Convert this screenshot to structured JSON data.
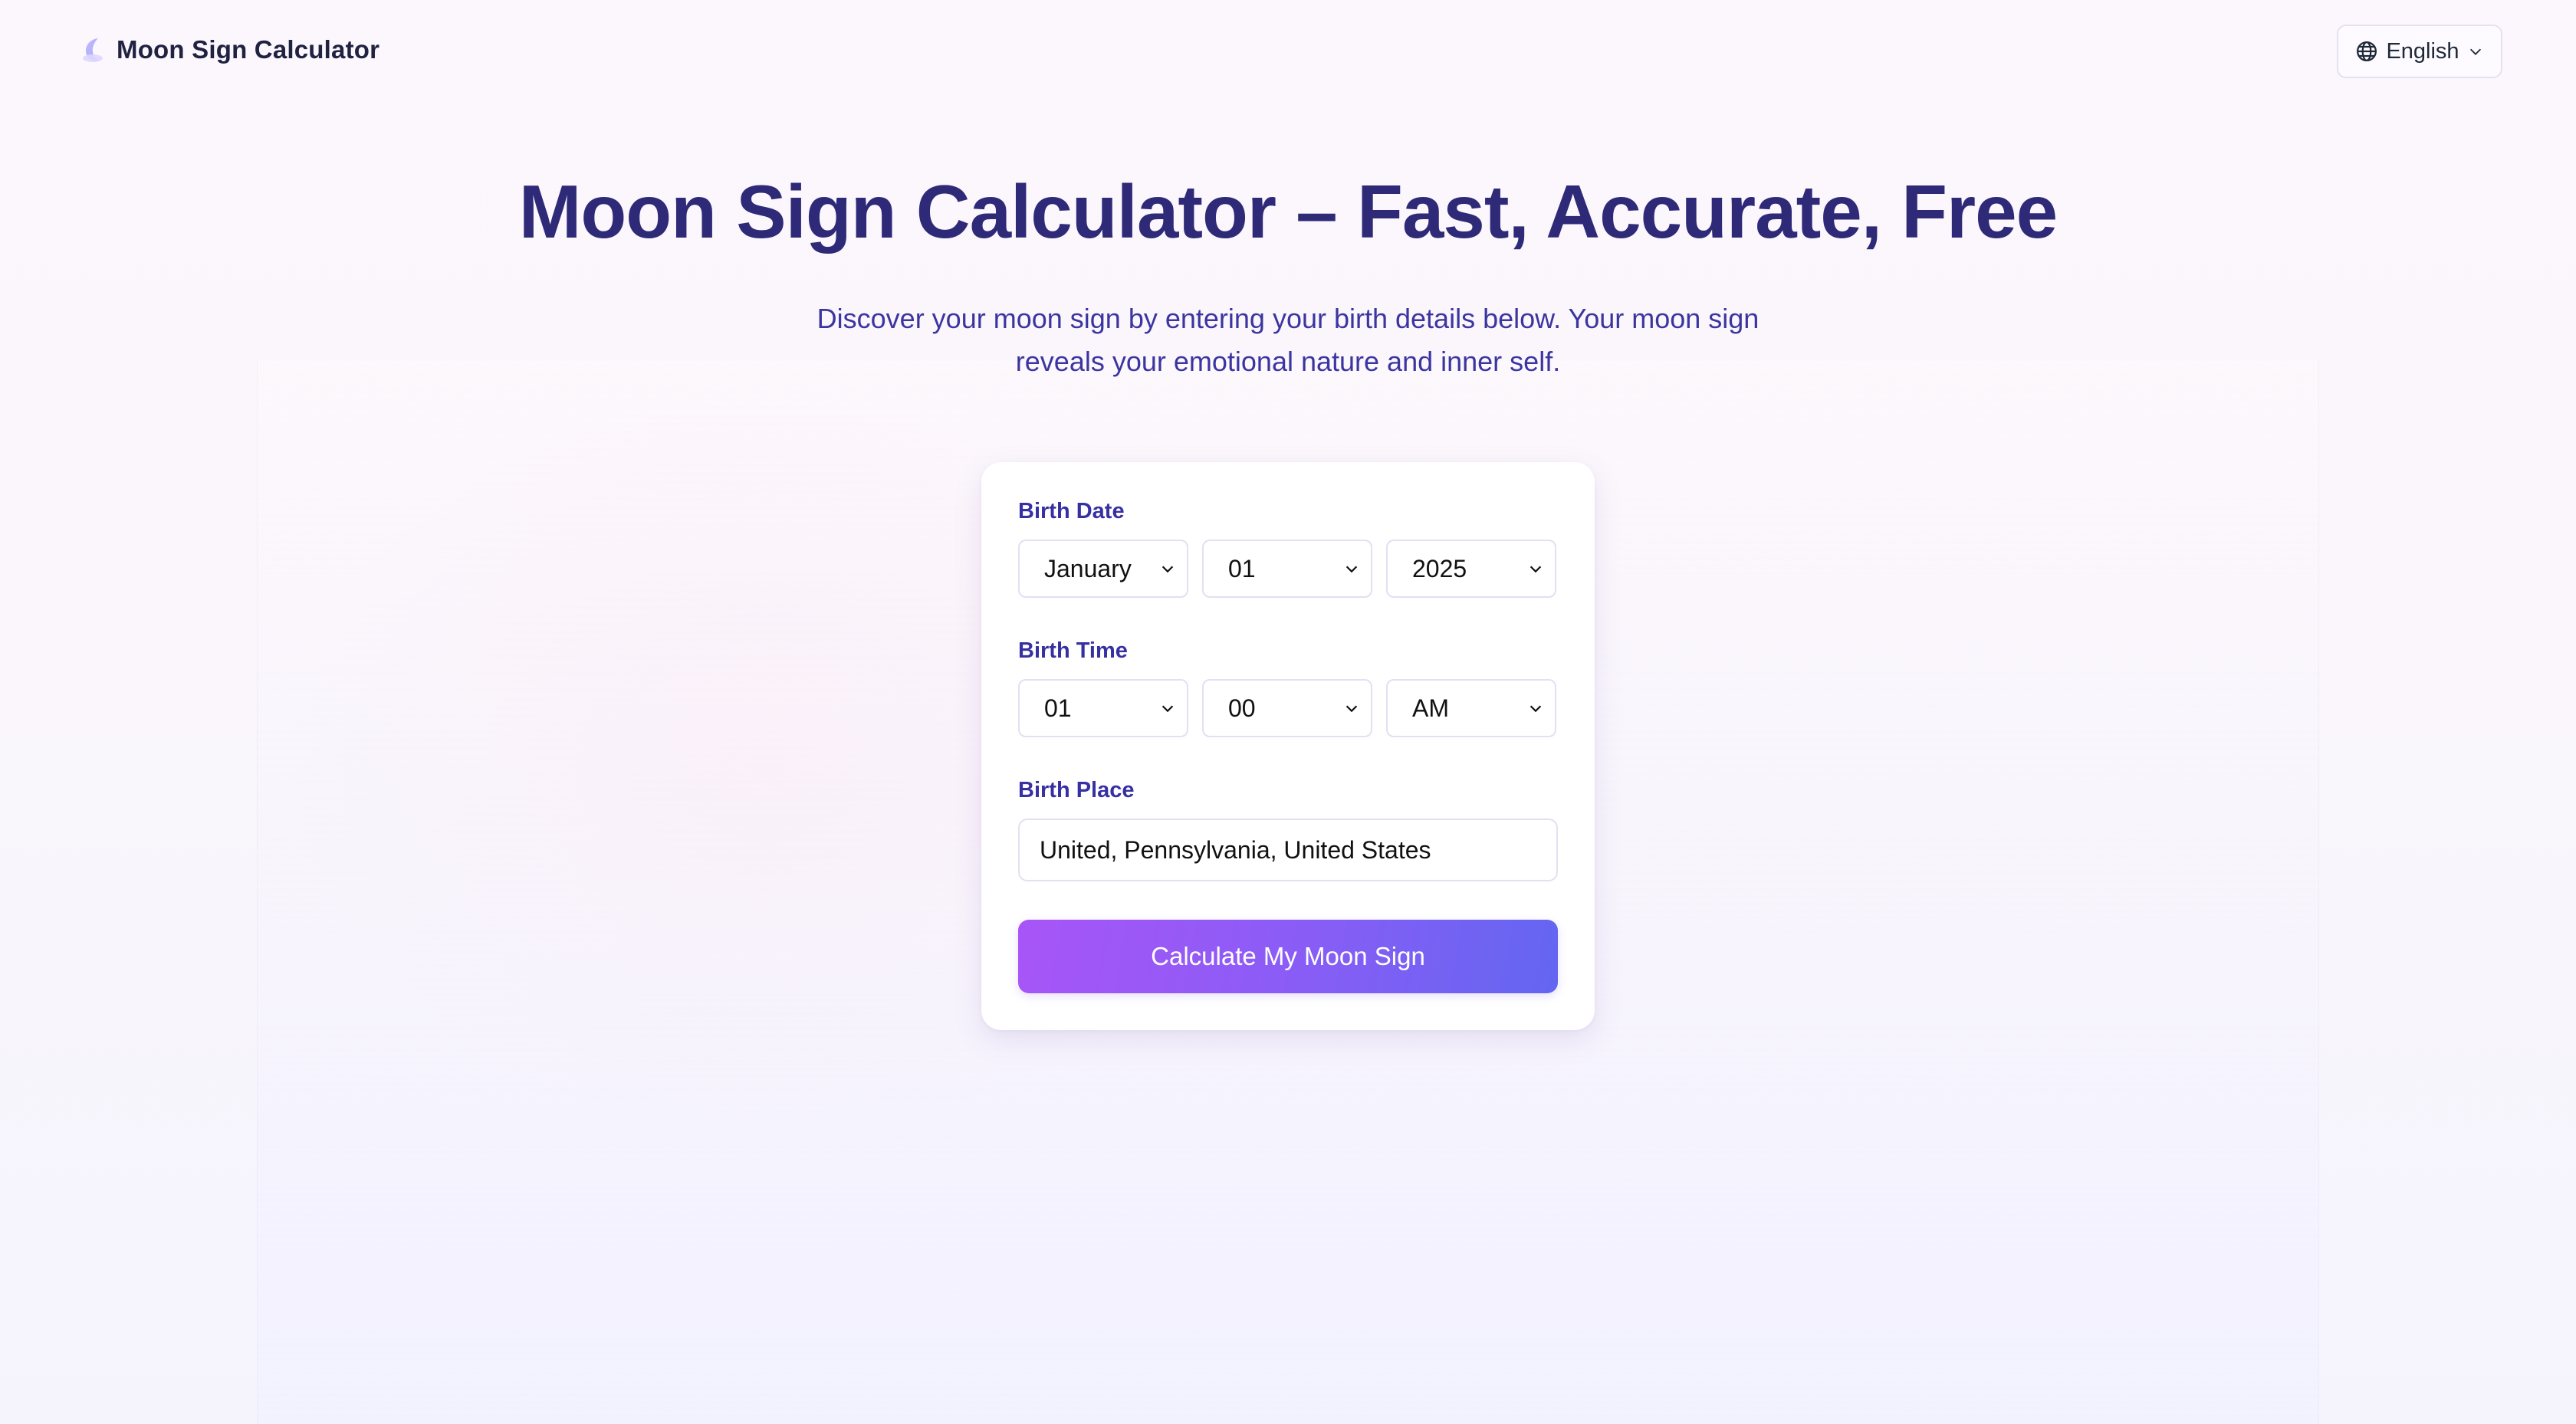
{
  "header": {
    "brand_title": "Moon Sign Calculator",
    "brand_icon": "moon-icon",
    "language_label": "English",
    "language_icon": "globe-icon"
  },
  "hero": {
    "title": "Moon Sign Calculator – Fast, Accurate, Free",
    "subtitle": "Discover your moon sign by entering your birth details below. Your moon sign reveals your emotional nature and inner self."
  },
  "form": {
    "birth_date": {
      "label": "Birth Date",
      "month": "January",
      "day": "01",
      "year": "2025"
    },
    "birth_time": {
      "label": "Birth Time",
      "hour": "01",
      "minute": "00",
      "period": "AM"
    },
    "birth_place": {
      "label": "Birth Place",
      "value": "United, Pennsylvania, United States"
    },
    "submit_label": "Calculate My Moon Sign"
  },
  "colors": {
    "title": "#2e2a78",
    "label": "#3730a3",
    "button_start": "#a855f7",
    "button_end": "#6366f1"
  }
}
